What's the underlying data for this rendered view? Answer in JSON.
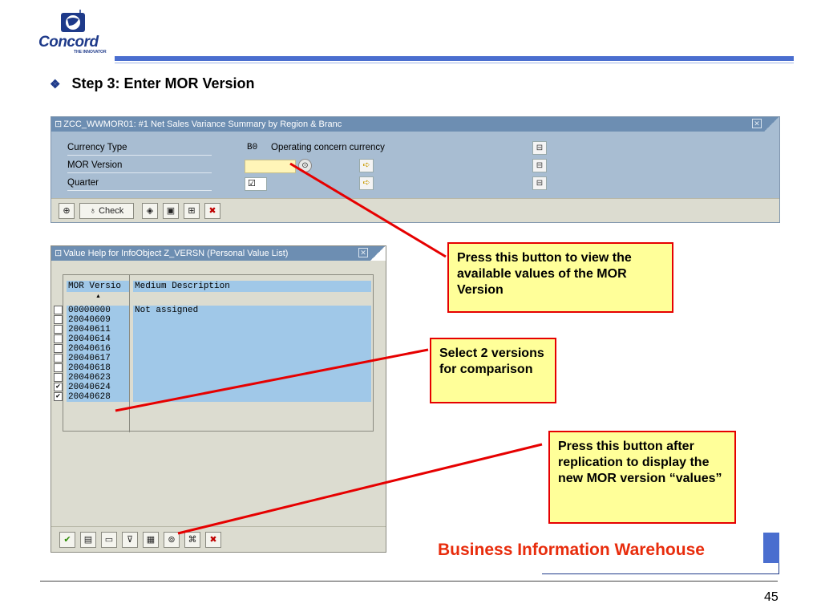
{
  "logo": {
    "name": "Concord",
    "tagline": "THE INNOVATOR"
  },
  "step": {
    "bullet": "❖",
    "title": "Step 3: Enter MOR Version"
  },
  "window1": {
    "title": "ZCC_WWMOR01: #1 Net Sales Variance Summary by Region & Branc",
    "title_icon": "document-icon",
    "close_icon": "close-icon",
    "rows": [
      {
        "label": "Currency Type",
        "code": "B0",
        "description": "Operating concern currency"
      },
      {
        "label": "MOR Version",
        "value": ""
      },
      {
        "label": "Quarter",
        "value": "☑"
      }
    ],
    "toolbar": [
      {
        "icon": "execute-icon",
        "glyph": "⊕"
      },
      {
        "icon": "check-icon",
        "glyph": "♁",
        "label": "Check"
      },
      {
        "icon": "variant-icon",
        "glyph": "◈"
      },
      {
        "icon": "save-icon",
        "glyph": "▣"
      },
      {
        "icon": "attributes-icon",
        "glyph": "⊞"
      },
      {
        "icon": "cancel-icon",
        "glyph": "✖"
      }
    ]
  },
  "window2": {
    "title": "Value Help for InfoObject Z_VERSN (Personal Value List)",
    "headers": [
      "MOR Versio",
      "Medium Description"
    ],
    "rows": [
      {
        "version": "00000000",
        "description": "Not assigned",
        "checked": false
      },
      {
        "version": "20040609",
        "description": "",
        "checked": false
      },
      {
        "version": "20040611",
        "description": "",
        "checked": false
      },
      {
        "version": "20040614",
        "description": "",
        "checked": false
      },
      {
        "version": "20040616",
        "description": "",
        "checked": false
      },
      {
        "version": "20040617",
        "description": "",
        "checked": false
      },
      {
        "version": "20040618",
        "description": "",
        "checked": false
      },
      {
        "version": "20040623",
        "description": "",
        "checked": false
      },
      {
        "version": "20040624",
        "description": "",
        "checked": true
      },
      {
        "version": "20040628",
        "description": "",
        "checked": true
      }
    ],
    "toolbar": [
      {
        "icon": "confirm-icon",
        "glyph": "✔"
      },
      {
        "icon": "select-all-icon",
        "glyph": "▤"
      },
      {
        "icon": "deselect-all-icon",
        "glyph": "▭"
      },
      {
        "icon": "filter-icon",
        "glyph": "⊽"
      },
      {
        "icon": "sort-icon",
        "glyph": "▦"
      },
      {
        "icon": "refresh-icon",
        "glyph": "⊚"
      },
      {
        "icon": "find-icon",
        "glyph": "⌘"
      },
      {
        "icon": "cancel-icon",
        "glyph": "✖"
      }
    ]
  },
  "callouts": {
    "view_values": "Press this button to view the available values of the MOR Version",
    "select_versions": "Select 2 versions for comparison",
    "after_replication": "Press this button after replication to display the new MOR version “values”"
  },
  "footer": {
    "brand": "Business Information Warehouse",
    "page_number": "45"
  },
  "colors": {
    "accent_blue": "#4a6ecf",
    "callout_bg": "#ffff99",
    "callout_border": "#e60000",
    "brand_red": "#e82c0c"
  }
}
